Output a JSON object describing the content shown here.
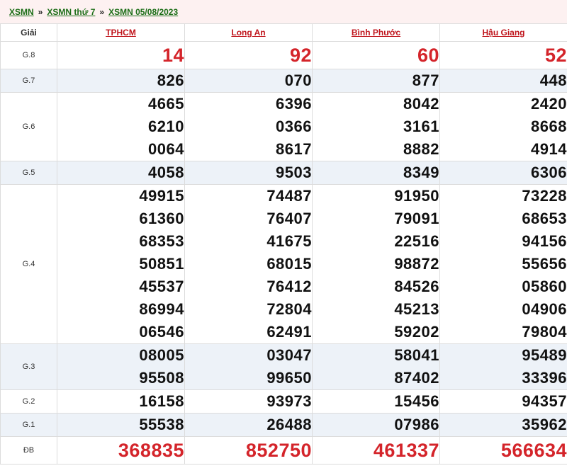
{
  "breadcrumb": {
    "item1": "XSMN",
    "sep": "»",
    "item2": "XSMN thứ 7",
    "item3": "XSMN 05/08/2023"
  },
  "table": {
    "header": {
      "giai": "Giải",
      "p1": "TPHCM",
      "p2": "Long An",
      "p3": "Bình Phước",
      "p4": "Hậu Giang"
    },
    "labels": {
      "g8": "G.8",
      "g7": "G.7",
      "g6": "G.6",
      "g5": "G.5",
      "g4": "G.4",
      "g3": "G.3",
      "g2": "G.2",
      "g1": "G.1",
      "db": "ĐB"
    },
    "g8": [
      [
        "14"
      ],
      [
        "92"
      ],
      [
        "60"
      ],
      [
        "52"
      ]
    ],
    "g7": [
      [
        "826"
      ],
      [
        "070"
      ],
      [
        "877"
      ],
      [
        "448"
      ]
    ],
    "g6": [
      [
        "4665",
        "6210",
        "0064"
      ],
      [
        "6396",
        "0366",
        "8617"
      ],
      [
        "8042",
        "3161",
        "8882"
      ],
      [
        "2420",
        "8668",
        "4914"
      ]
    ],
    "g5": [
      [
        "4058"
      ],
      [
        "9503"
      ],
      [
        "8349"
      ],
      [
        "6306"
      ]
    ],
    "g4": [
      [
        "49915",
        "61360",
        "68353",
        "50851",
        "45537",
        "86994",
        "06546"
      ],
      [
        "74487",
        "76407",
        "41675",
        "68015",
        "76412",
        "72804",
        "62491"
      ],
      [
        "91950",
        "79091",
        "22516",
        "98872",
        "84526",
        "45213",
        "59202"
      ],
      [
        "73228",
        "68653",
        "94156",
        "55656",
        "05860",
        "04906",
        "79804"
      ]
    ],
    "g3": [
      [
        "08005",
        "95508"
      ],
      [
        "03047",
        "99650"
      ],
      [
        "58041",
        "87402"
      ],
      [
        "95489",
        "33396"
      ]
    ],
    "g2": [
      [
        "16158"
      ],
      [
        "93973"
      ],
      [
        "15456"
      ],
      [
        "94357"
      ]
    ],
    "g1": [
      [
        "55538"
      ],
      [
        "26488"
      ],
      [
        "07986"
      ],
      [
        "35962"
      ]
    ],
    "db": [
      [
        "368835"
      ],
      [
        "852750"
      ],
      [
        "461337"
      ],
      [
        "566634"
      ]
    ]
  },
  "colors": {
    "accent_red": "#d4242a",
    "link_green": "#1b6d16",
    "alt_row": "#edf2f8",
    "breadcrumb_bg": "#fdf1f1"
  }
}
